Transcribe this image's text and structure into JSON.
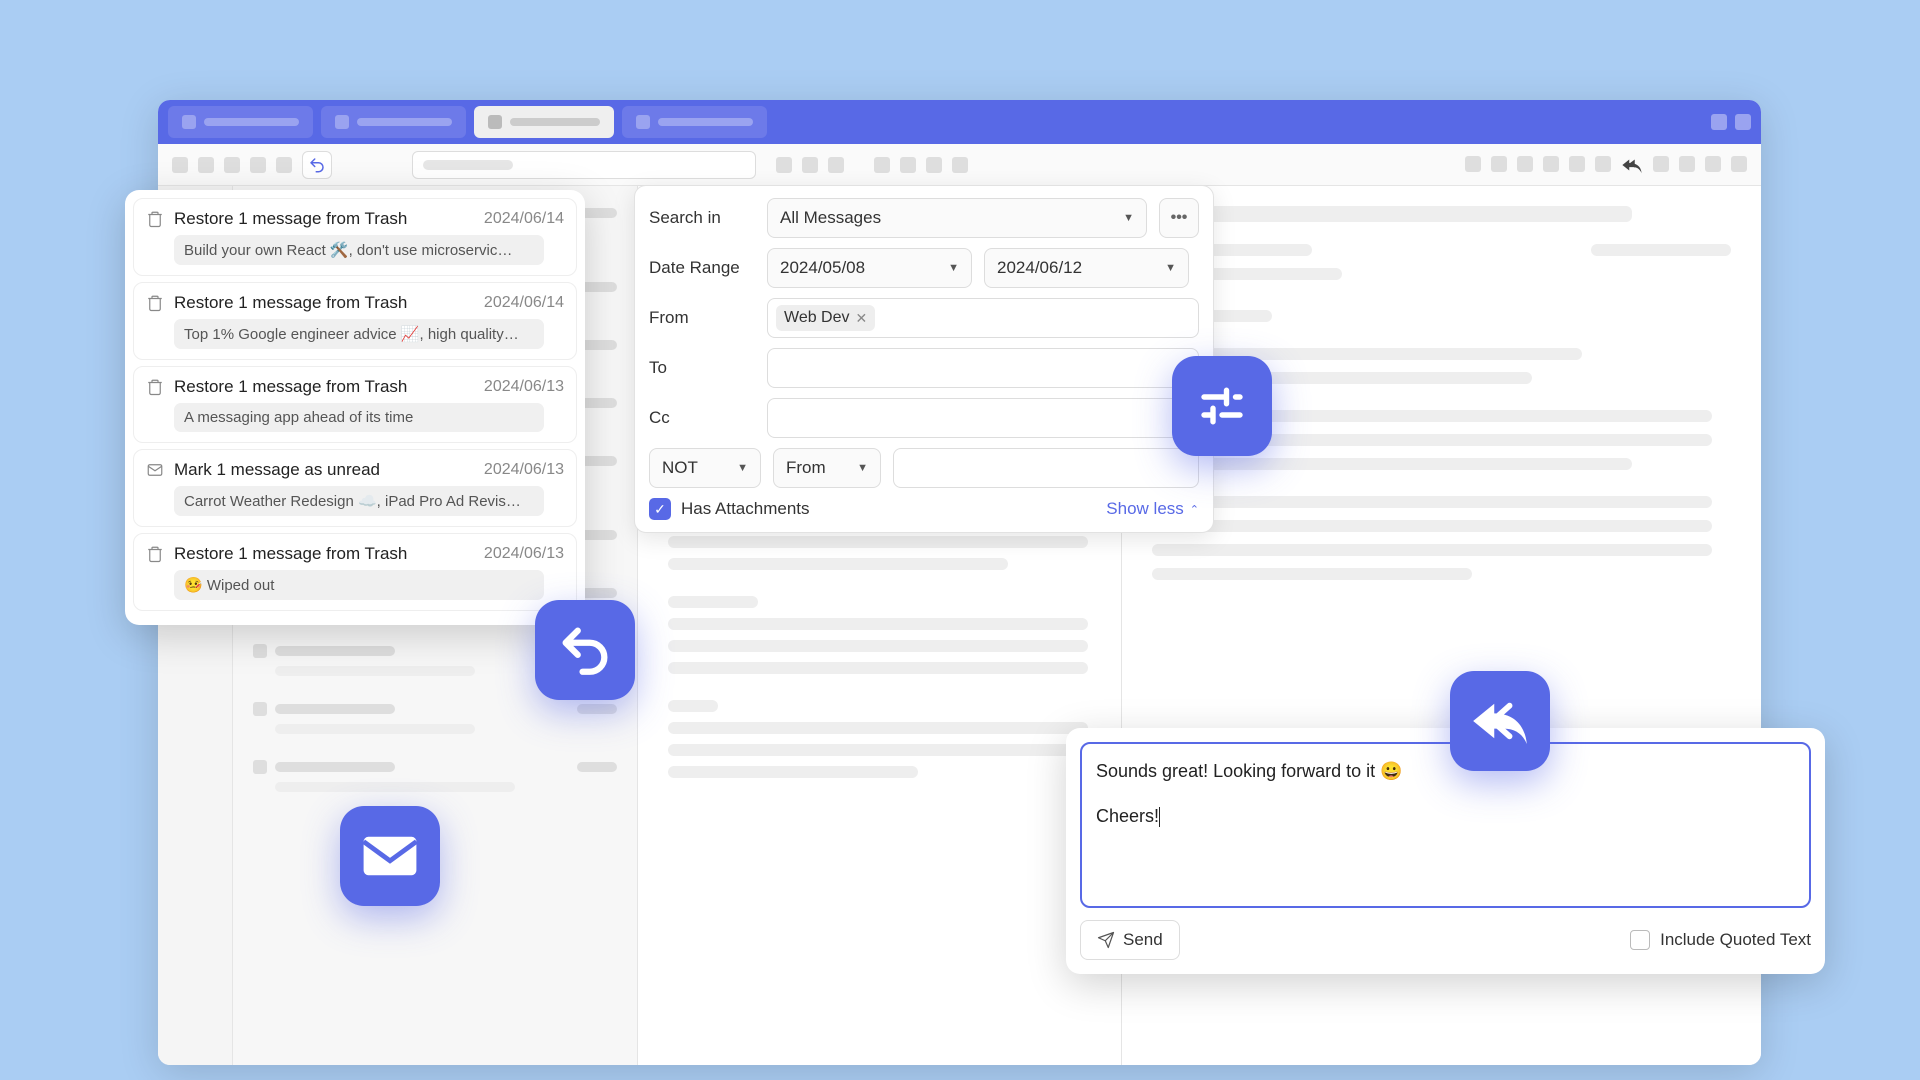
{
  "filters": {
    "search_in_label": "Search in",
    "search_in_value": "All Messages",
    "date_range_label": "Date Range",
    "date_from": "2024/05/08",
    "date_to": "2024/06/12",
    "from_label": "From",
    "from_chip": "Web Dev",
    "to_label": "To",
    "cc_label": "Cc",
    "not_label": "NOT",
    "not_field": "From",
    "has_attachments": "Has Attachments",
    "show_less": "Show less",
    "more": "•••"
  },
  "undo_list": [
    {
      "icon": "trash",
      "title": "Restore 1 message from Trash",
      "date": "2024/06/14",
      "preview": "Build your own React 🛠️, don't use microservic…"
    },
    {
      "icon": "trash",
      "title": "Restore 1 message from Trash",
      "date": "2024/06/14",
      "preview": "Top 1% Google engineer advice 📈, high quality…"
    },
    {
      "icon": "trash",
      "title": "Restore 1 message from Trash",
      "date": "2024/06/13",
      "preview": "A messaging app ahead of its time"
    },
    {
      "icon": "mail",
      "title": "Mark 1 message as unread",
      "date": "2024/06/13",
      "preview": "Carrot Weather Redesign ☁️, iPad Pro Ad Revis…"
    },
    {
      "icon": "trash",
      "title": "Restore 1 message from Trash",
      "date": "2024/06/13",
      "preview": "🤒 Wiped out"
    }
  ],
  "compose": {
    "line1": "Sounds great! Looking forward to it 😀",
    "line2": "Cheers!",
    "send": "Send",
    "quoted": "Include Quoted Text"
  }
}
